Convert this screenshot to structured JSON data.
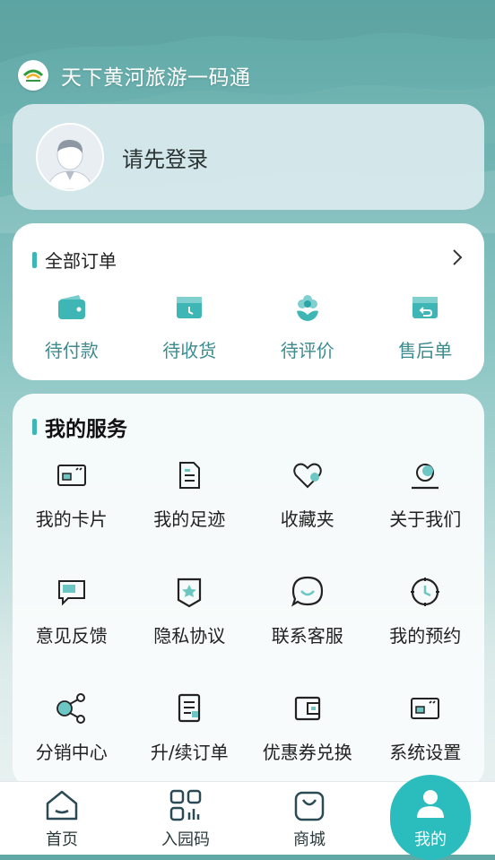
{
  "header": {
    "title": "天下黄河旅游一码通",
    "logo_icon": "yellow-river-logo"
  },
  "login": {
    "prompt": "请先登录"
  },
  "orders": {
    "title": "全部订单",
    "items": [
      {
        "label": "待付款",
        "icon": "wallet-icon"
      },
      {
        "label": "待收货",
        "icon": "box-clock-icon"
      },
      {
        "label": "待评价",
        "icon": "flower-icon"
      },
      {
        "label": "售后单",
        "icon": "return-box-icon"
      }
    ]
  },
  "services": {
    "title": "我的服务",
    "items": [
      {
        "label": "我的卡片",
        "icon": "card-icon"
      },
      {
        "label": "我的足迹",
        "icon": "document-icon"
      },
      {
        "label": "收藏夹",
        "icon": "heart-icon"
      },
      {
        "label": "关于我们",
        "icon": "about-icon"
      },
      {
        "label": "意见反馈",
        "icon": "feedback-icon"
      },
      {
        "label": "隐私协议",
        "icon": "shield-icon"
      },
      {
        "label": "联系客服",
        "icon": "chat-icon"
      },
      {
        "label": "我的预约",
        "icon": "clock-icon"
      },
      {
        "label": "分销中心",
        "icon": "share-icon"
      },
      {
        "label": "升/续订单",
        "icon": "order-list-icon"
      },
      {
        "label": "优惠券兑换",
        "icon": "wallet-coupon-icon"
      },
      {
        "label": "系统设置",
        "icon": "settings-card-icon"
      }
    ]
  },
  "tabbar": {
    "items": [
      {
        "label": "首页",
        "icon": "home-icon"
      },
      {
        "label": "入园码",
        "icon": "qr-grid-icon"
      },
      {
        "label": "商城",
        "icon": "shopping-bag-icon"
      },
      {
        "label": "我的",
        "icon": "user-icon",
        "active": true
      }
    ]
  },
  "colors": {
    "accent": "#2bbcbd",
    "order_text": "#3c8b8e",
    "section_bar": "#3fb6b6"
  }
}
